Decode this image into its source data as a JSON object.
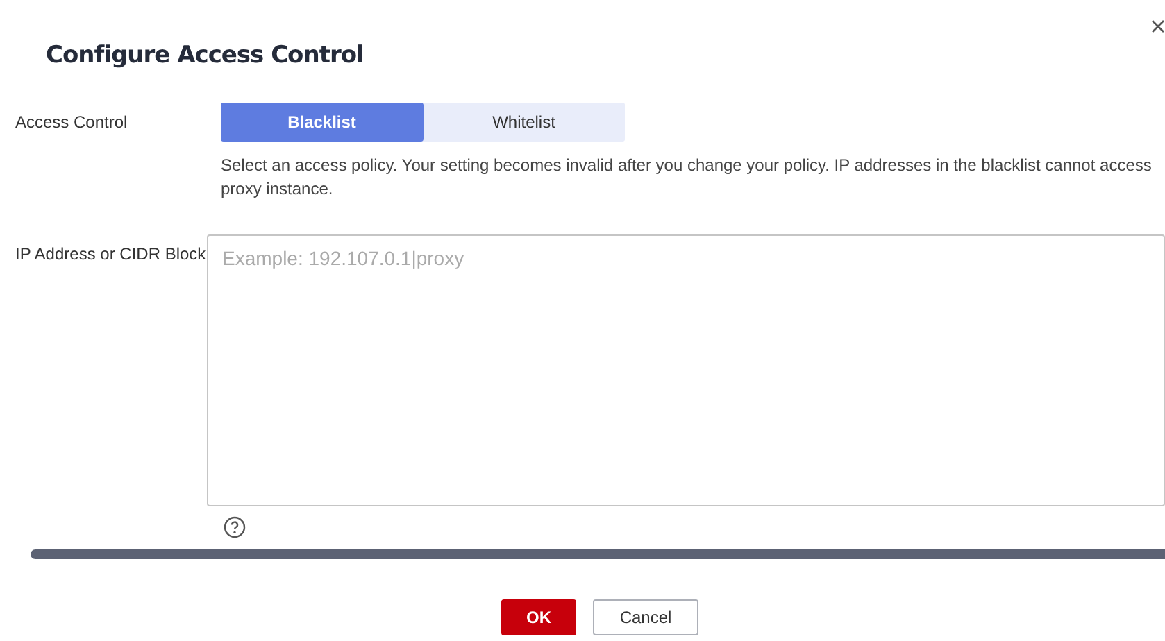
{
  "dialog": {
    "title": "Configure Access Control"
  },
  "access_control": {
    "label": "Access Control",
    "options": [
      {
        "label": "Blacklist",
        "selected": true
      },
      {
        "label": "Whitelist",
        "selected": false
      }
    ],
    "description": "Select an access policy. Your setting becomes invalid after you change your policy. IP addresses in the blacklist cannot access\nproxy instance."
  },
  "ip_field": {
    "label": "IP Address or CIDR Block",
    "placeholder": "Example: 192.107.0.1|proxy"
  },
  "buttons": [
    {
      "label": "OK",
      "kind": "primary"
    },
    {
      "label": "Cancel",
      "kind": "secondary"
    }
  ]
}
